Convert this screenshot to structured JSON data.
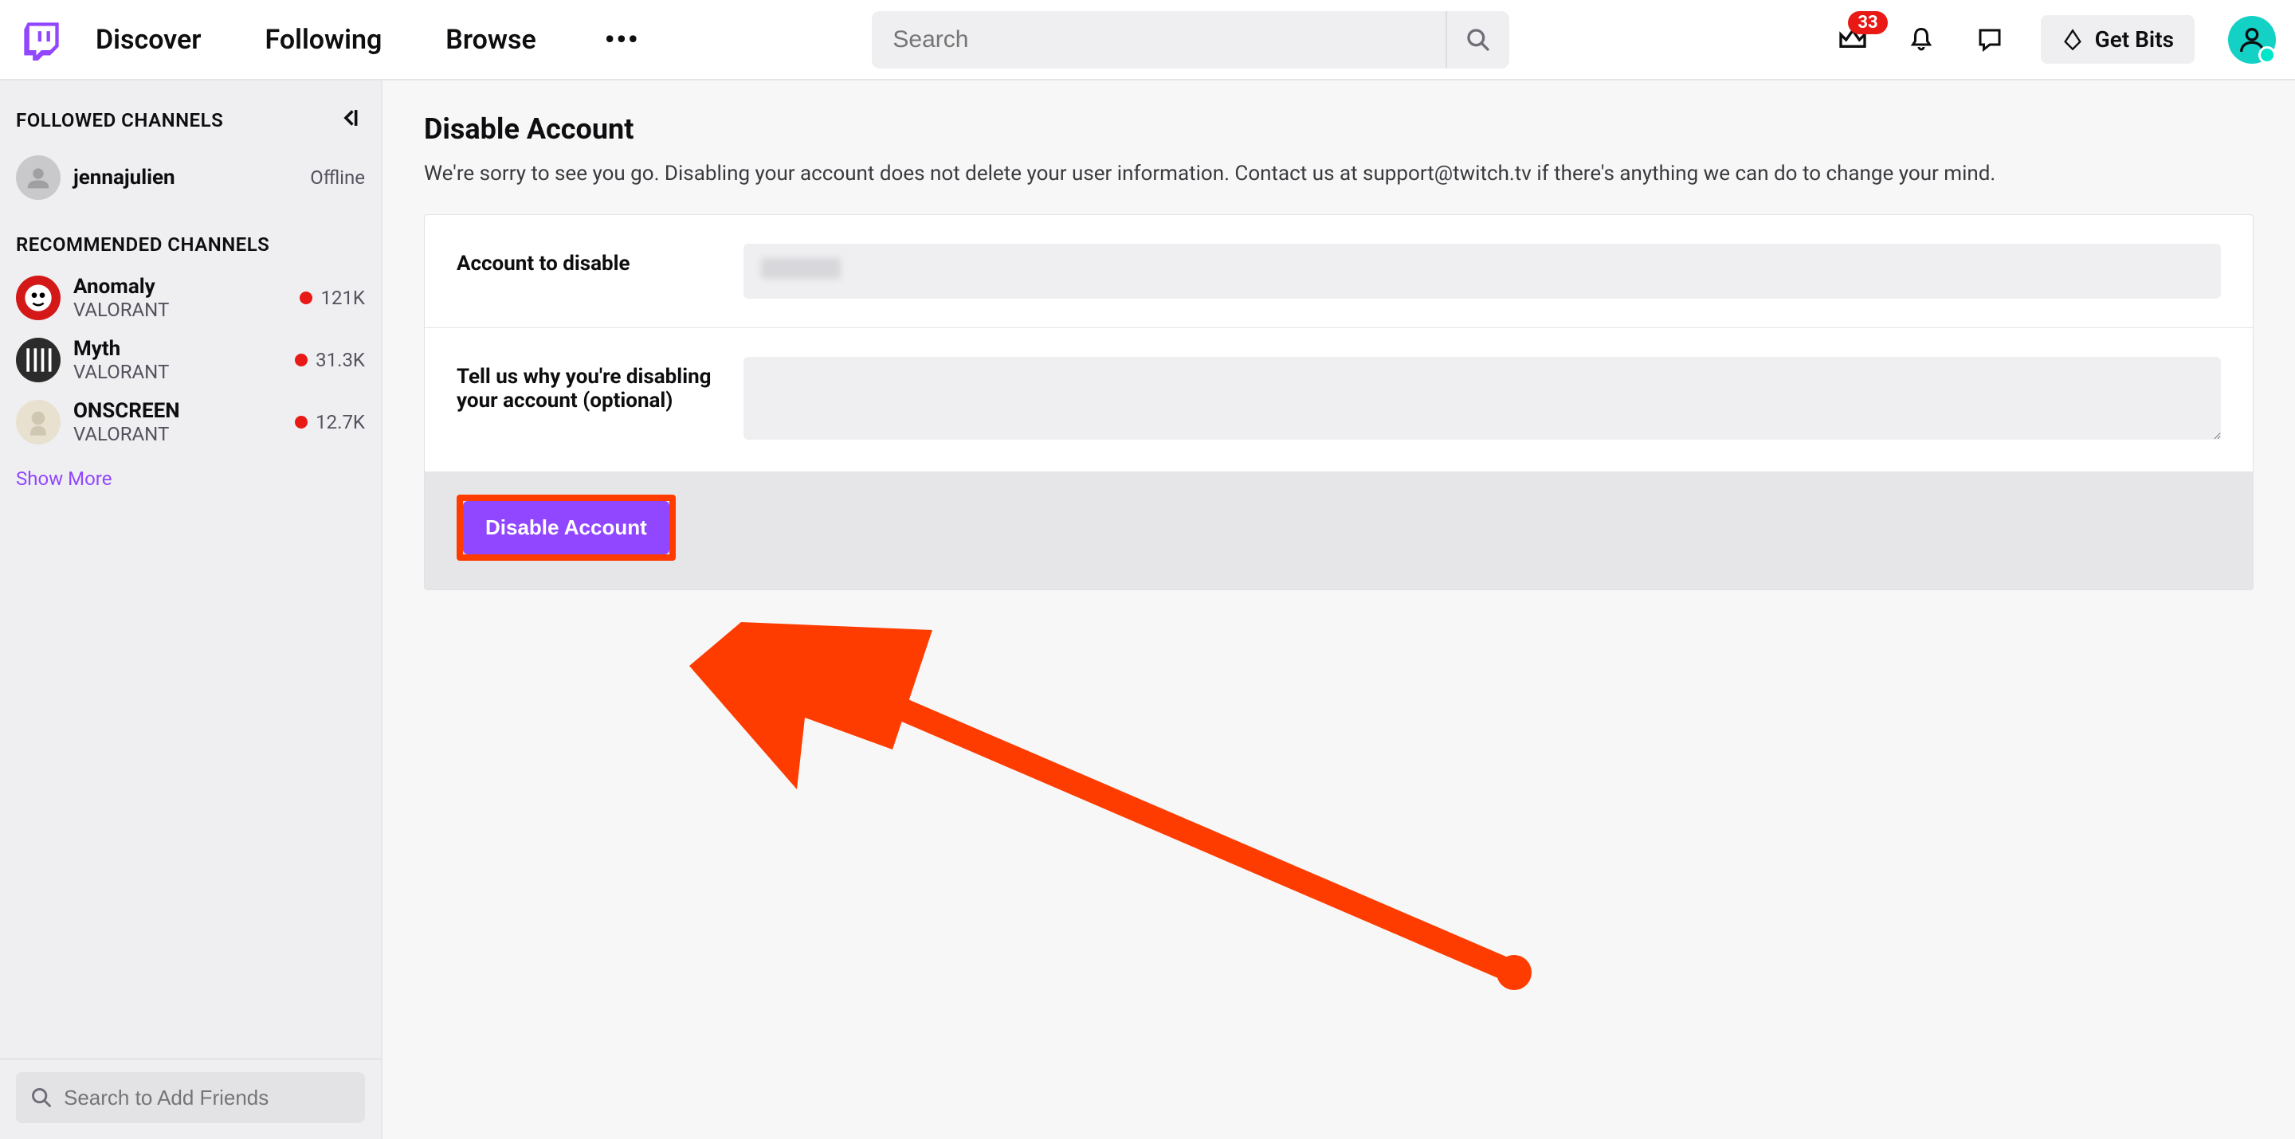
{
  "colors": {
    "brand_purple": "#9147ff",
    "badge_red": "#e91916",
    "annotation_red": "#ff3c00",
    "avatar_teal": "#14d1c6"
  },
  "topnav": {
    "links": [
      {
        "label": "Discover"
      },
      {
        "label": "Following"
      },
      {
        "label": "Browse"
      }
    ],
    "search_placeholder": "Search",
    "notifications_badge": "33",
    "getbits_label": "Get Bits"
  },
  "sidebar": {
    "followed_title": "FOLLOWED CHANNELS",
    "followed": [
      {
        "name": "jennajulien",
        "subtitle": "",
        "status": "Offline",
        "live": false
      }
    ],
    "recommended_title": "RECOMMENDED CHANNELS",
    "recommended": [
      {
        "name": "Anomaly",
        "subtitle": "VALORANT",
        "viewers": "121K",
        "live": true
      },
      {
        "name": "Myth",
        "subtitle": "VALORANT",
        "viewers": "31.3K",
        "live": true
      },
      {
        "name": "ONSCREEN",
        "subtitle": "VALORANT",
        "viewers": "12.7K",
        "live": true
      }
    ],
    "show_more": "Show More",
    "friends_search_placeholder": "Search to Add Friends"
  },
  "page": {
    "title": "Disable Account",
    "description": "We're sorry to see you go. Disabling your account does not delete your user information. Contact us at support@twitch.tv if there's anything we can do to change your mind.",
    "account_label": "Account to disable",
    "reason_label": "Tell us why you're disabling your account (optional)",
    "button_label": "Disable Account"
  }
}
